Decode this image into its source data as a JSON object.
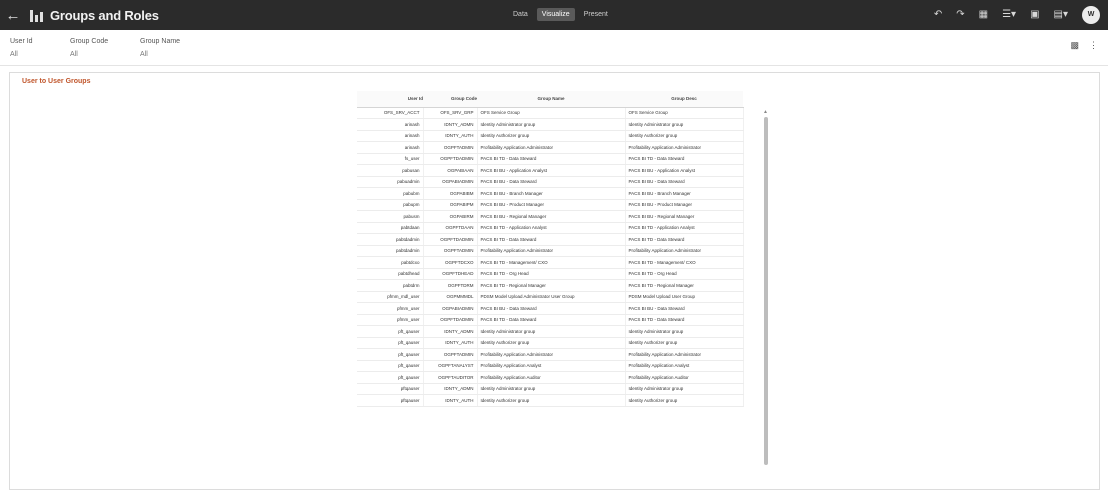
{
  "header": {
    "title": "Groups and Roles",
    "modes": [
      "Data",
      "Visualize",
      "Present"
    ],
    "active_mode": "Visualize",
    "avatar_initials": "W"
  },
  "filters": [
    {
      "label": "User Id",
      "value": "All"
    },
    {
      "label": "Group Code",
      "value": "All"
    },
    {
      "label": "Group Name",
      "value": "All"
    }
  ],
  "viz": {
    "title": "User to User Groups",
    "columns": [
      "User Id",
      "Group Code",
      "Group Name",
      "Group Desc"
    ],
    "rows": [
      [
        "OFS_SRV_ACCT",
        "OFS_SRV_GRP",
        "OFS Service Group",
        "OFS Service Group"
      ],
      [
        "arinash",
        "IDNTY_ADMN",
        "Identity Administrator group",
        "Identity Administrator group"
      ],
      [
        "arinash",
        "IDNTY_AUTH",
        "Identity Authorizer group",
        "Identity Authorizer group"
      ],
      [
        "arinash",
        "OGPFTADMIN",
        "Profitability Application Administrator",
        "Profitability Application Administrator"
      ],
      [
        "fs_user",
        "OGPFTDADMIN",
        "PACS BI TD - Data Steward",
        "PACS BI TD - Data Steward"
      ],
      [
        "pabusan",
        "OGPABIAAN",
        "PACS BI BU - Application Analyst",
        "PACS BI BU - Application Analyst"
      ],
      [
        "pabuadmin",
        "OGPABIADMIN",
        "PACS BI BU - Data Steward",
        "PACS BI BU - Data Steward"
      ],
      [
        "pabubm",
        "OGPABIBM",
        "PACS BI BU - Branch Manager",
        "PACS BI BU - Branch Manager"
      ],
      [
        "pabupm",
        "OGPABIPM",
        "PACS BI BU - Product Manager",
        "PACS BI BU - Product Manager"
      ],
      [
        "pabusm",
        "OGPABIRM",
        "PACS BI BU - Regional Manager",
        "PACS BI BU - Regional Manager"
      ],
      [
        "pabtdaan",
        "OGPFTDAAN",
        "PACS BI TD - Application Analyst",
        "PACS BI TD - Application Analyst"
      ],
      [
        "pabtdadmin",
        "OGPFTDADMIN",
        "PACS BI TD - Data Steward",
        "PACS BI TD - Data Steward"
      ],
      [
        "pabtdadmin",
        "OGPFTADMIN",
        "Profitability Application Administrator",
        "Profitability Application Administrator"
      ],
      [
        "pabtdcxo",
        "OGPFTDCXO",
        "PACS BI TD - Management/ CXO",
        "PACS BI TD - Management/ CXO"
      ],
      [
        "pabtdhead",
        "OGPFTDHEAD",
        "PACS BI TD - Org Head",
        "PACS BI TD - Org Head"
      ],
      [
        "pabtdrm",
        "OGPFTDRM",
        "PACS BI TD - Regional Manager",
        "PACS BI TD - Regional Manager"
      ],
      [
        "pfmm_mdl_user",
        "OGPMMMDL",
        "PDSM Model Upload Administrator User Group",
        "PDSM Model Upload User Group"
      ],
      [
        "pfmm_user",
        "OGPABIADMIN",
        "PACS BI BU - Data Steward",
        "PACS BI BU - Data Steward"
      ],
      [
        "pfmm_user",
        "OGPFTDADMIN",
        "PACS BI TD - Data Steward",
        "PACS BI TD - Data Steward"
      ],
      [
        "pft_qauser",
        "IDNTY_ADMN",
        "Identity Administrator group",
        "Identity Administrator group"
      ],
      [
        "pft_qauser",
        "IDNTY_AUTH",
        "Identity Authorizer group",
        "Identity Authorizer group"
      ],
      [
        "pft_qauser",
        "OGPFTADMIN",
        "Profitability Application Administrator",
        "Profitability Application Administrator"
      ],
      [
        "pft_qauser",
        "OGPFTANALYST",
        "Profitability Application Analyst",
        "Profitability Application Analyst"
      ],
      [
        "pft_qauser",
        "OGPFTAUDITOR",
        "Profitability Application Auditor",
        "Profitability Application Auditor"
      ],
      [
        "pftqauser",
        "IDNTY_ADMN",
        "Identity Administrator group",
        "Identity Administrator group"
      ],
      [
        "pftqauser",
        "IDNTY_AUTH",
        "Identity Authorizer group",
        "Identity Authorizer group"
      ]
    ]
  }
}
